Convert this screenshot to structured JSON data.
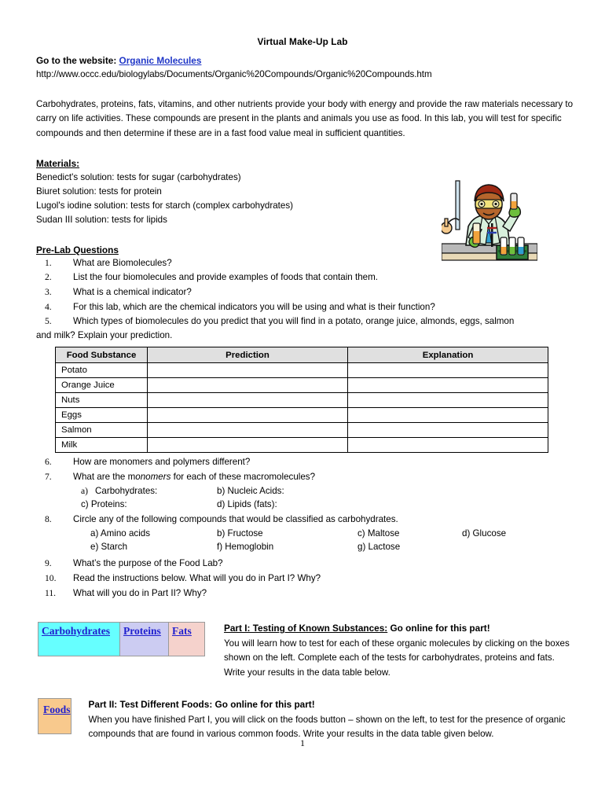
{
  "document": {
    "title": "Virtual Make-Up Lab",
    "website_label": "Go to the website: ",
    "website_link_text": "Organic Molecules",
    "url": "http://www.occc.edu/biologylabs/Documents/Organic%20Compounds/Organic%20Compounds.htm",
    "intro": "Carbohydrates, proteins, fats, vitamins, and other nutrients provide your body with energy and provide the raw materials necessary to carry on life activities. These compounds are present in the plants and animals you use as food. In this lab, you will test for specific compounds and then determine if these are in a fast food value meal in sufficient quantities.",
    "page_number": "1"
  },
  "materials": {
    "heading": "Materials:",
    "items": [
      "Benedict's solution: tests for sugar (carbohydrates)",
      "Biuret solution: tests for protein",
      "Lugol's iodine solution:  tests for starch (complex carbohydrates)",
      "Sudan III solution: tests for lipids"
    ]
  },
  "prelab": {
    "heading": "Pre-Lab Questions",
    "questions": [
      {
        "num": "1.",
        "text": "What are Biomolecules?"
      },
      {
        "num": "2.",
        "text": "List the four biomolecules and provide examples of foods that contain them."
      },
      {
        "num": "3.",
        "text": "What is a chemical indicator?"
      },
      {
        "num": "4.",
        "text": "For this lab, which are the chemical indicators you will be using and what is their function?"
      },
      {
        "num": "5.",
        "text": "Which types of biomolecules do you predict that you will find in a potato, orange juice, almonds, eggs, salmon"
      }
    ],
    "q5_continuation": "and milk? Explain your prediction.",
    "questions_after_table": [
      {
        "num": "6.",
        "text": "How are monomers and polymers different?"
      },
      {
        "num": "7.",
        "text": "What are the monomers for each of these macromolecules?"
      },
      {
        "num": "8.",
        "text": "Circle any of the following compounds that would be classified as carbohydrates."
      },
      {
        "num": "9.",
        "text": "What’s the purpose of the Food Lab?"
      },
      {
        "num": "10.",
        "text": "Read the instructions below. What will you do in Part I?  Why?"
      },
      {
        "num": "11.",
        "text": "What will you do in Part II?  Why?"
      }
    ],
    "q7_prefix": "What are the m",
    "q7_italic": "onomers",
    "q7_suffix": " for each of these macromolecules?",
    "q7_options": {
      "a": "a)",
      "a_text": "Carbohydrates:",
      "b": "b) Nucleic Acids:",
      "c": "c) Proteins:",
      "d": "d) Lipids (fats):"
    },
    "q8_options": {
      "a": "a) Amino acids",
      "b": "b) Fructose",
      "c": "c) Maltose",
      "d": "d) Glucose",
      "e": "e) Starch",
      "f": "f) Hemoglobin",
      "g": "g) Lactose"
    }
  },
  "food_table": {
    "headers": [
      "Food Substance",
      "Prediction",
      "Explanation"
    ],
    "rows": [
      {
        "substance": "Potato",
        "prediction": "",
        "explanation": ""
      },
      {
        "substance": "Orange Juice",
        "prediction": "",
        "explanation": ""
      },
      {
        "substance": "Nuts",
        "prediction": "",
        "explanation": ""
      },
      {
        "substance": "Eggs",
        "prediction": "",
        "explanation": ""
      },
      {
        "substance": "Salmon",
        "prediction": "",
        "explanation": ""
      },
      {
        "substance": "Milk",
        "prediction": "",
        "explanation": ""
      }
    ]
  },
  "part1": {
    "buttons": [
      {
        "label": "Carbohydrates",
        "color": "#66FFFF"
      },
      {
        "label": "Proteins",
        "color": "#CCCCF2"
      },
      {
        "label": "Fats",
        "color": "#F5D2CC"
      }
    ],
    "title_underlined": "Part I: Testing of Known Substances:",
    "title_plain": " Go online for this part!",
    "body": "You will learn how to test for each of these organic molecules by clicking on the boxes shown on the left. Complete each of the tests for carbohydrates, proteins and fats.  Write your results in the data table below."
  },
  "part2": {
    "button": {
      "label": "Foods",
      "color": "#F8C98D"
    },
    "title": "Part II: Test Different Foods: Go online for this part!",
    "body": "When you have finished Part I, you will click on the foods button – shown on the left, to test for the presence of organic compounds that are found in various common foods. Write your results in the data table given below."
  },
  "colors": {
    "link": "#1F36C7",
    "button_link": "#1F1FCF",
    "table_header_bg": "#E0E0E0",
    "border": "#000000"
  }
}
